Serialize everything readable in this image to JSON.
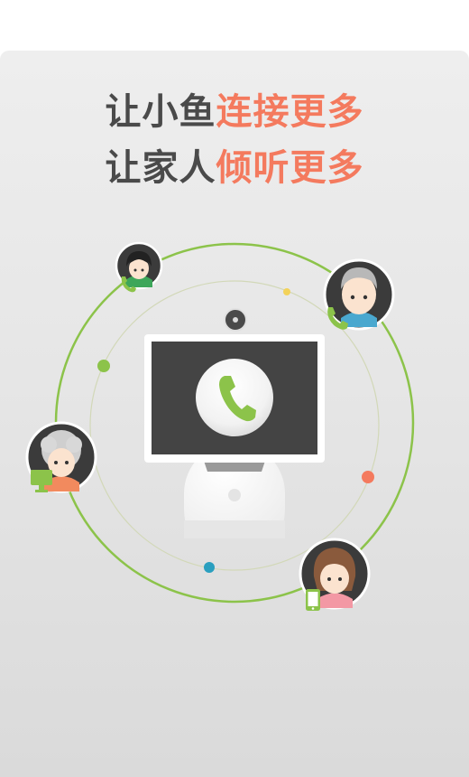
{
  "headline": {
    "line1": {
      "dark": "让小鱼",
      "accent": "连接更多"
    },
    "line2": {
      "dark": "让家人",
      "accent": "倾听更多"
    }
  },
  "colors": {
    "ring": "#8cc34a",
    "accent_text": "#f47a5e",
    "dark_text": "#4a4a4a",
    "screen": "#444444",
    "avatar_bg": "#3b3b3b"
  },
  "avatars": [
    {
      "name": "young-woman",
      "device": "phone-icon"
    },
    {
      "name": "grandfather",
      "device": "phone-icon"
    },
    {
      "name": "grandmother",
      "device": "monitor-icon"
    },
    {
      "name": "girl",
      "device": "mobile-icon"
    }
  ],
  "center": {
    "device": "robot-tv",
    "action": "phone-call-icon"
  }
}
